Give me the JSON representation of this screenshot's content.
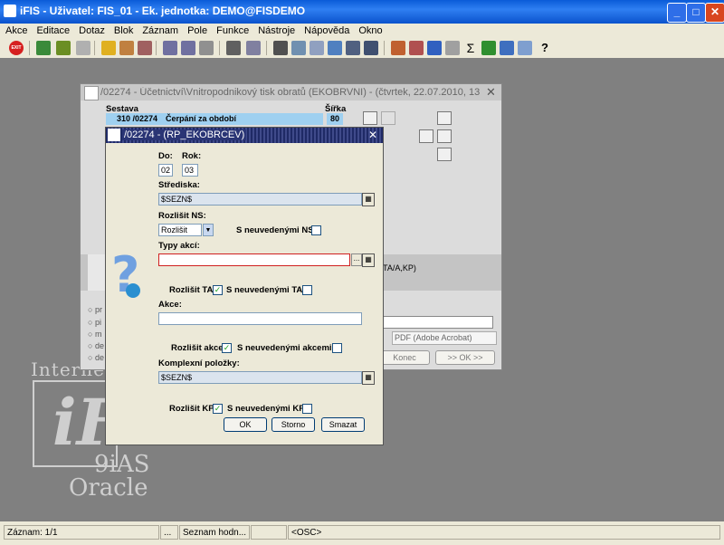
{
  "window": {
    "title": "iFIS - Uživatel: FIS_01 - Ek. jednotka: DEMO@FISDEMO",
    "min": "_",
    "max": "□",
    "close": "✕"
  },
  "menu": [
    "Akce",
    "Editace",
    "Dotaz",
    "Blok",
    "Záznam",
    "Pole",
    "Funkce",
    "Nástroje",
    "Nápověda",
    "Okno"
  ],
  "toolbar": {
    "exit_label": "EXIT",
    "icons": [
      "exit-icon",
      "save-icon",
      "print-icon",
      "folder-open-icon",
      "lock-icon",
      "db-icon",
      "sort-asc-icon",
      "sort-desc-icon",
      "filter-icon",
      "printer-icon",
      "preview-icon",
      "cut-icon",
      "copy-icon",
      "find-icon",
      "find-next-icon",
      "list-icon",
      "tree-icon",
      "calc-icon",
      "warning-icon",
      "triangle-icon",
      "clock-icon",
      "sum-icon",
      "excel-icon",
      "table-icon",
      "info-icon",
      "help-icon"
    ]
  },
  "logo": {
    "internet": "Interne",
    "oracle_9ias": "9iAS",
    "oracle": "Oracle"
  },
  "back_dialog": {
    "title": "/02274 - Účetnictví\\Vnitropodnikový tisk obratů (EKOBRVNI) - (čtvrtek, 22.07.2010, 13:40:52)",
    "close": "✕",
    "col_sestava": "Sestava",
    "col_sirka": "Šířka",
    "row_code": "310 /02274",
    "row_name": "Čerpání za období",
    "row_width": "80",
    "param_text": "TA/A,KP)",
    "radio_labels": [
      "pr",
      "pi",
      "m",
      "de",
      "de"
    ],
    "format_select": "PDF (Adobe Acrobat)",
    "btn_konec": "Konec",
    "btn_ok": ">> OK >>"
  },
  "front_dialog": {
    "title": "/02274 - (RP_EKOBRCEV)",
    "close": "✕",
    "lbl_do": "Do:",
    "lbl_rok": "Rok:",
    "val_do": "02",
    "val_rok": "03",
    "lbl_strediska": "Střediska:",
    "val_strediska": "$SEZN$",
    "lbl_rozlisit_ns": "Rozlišit NS:",
    "val_rozlisit_ns": "Rozlišit",
    "lbl_s_neuvedenymi_ns": "S neuvedenými NS",
    "lbl_typy_akci": "Typy akcí:",
    "val_typy_akci": "",
    "lbl_rozlisit_ta": "Rozlišit TA",
    "lbl_s_neuvedenymi_ta": "S neuvedenými TA",
    "lbl_akce": "Akce:",
    "val_akce": "",
    "lbl_rozlisit_akce": "Rozlišit akce",
    "lbl_s_neuvedenymi_akcemi": "S neuvedenými akcemi",
    "lbl_komplexni": "Komplexní položky:",
    "val_komplexni": "$SEZN$",
    "lbl_rozlisit_kp": "Rozlišit KP",
    "lbl_s_neuvedenymi_kp": "S neuvedenými KP",
    "btn_ok": "OK",
    "btn_storno": "Storno",
    "btn_smazat": "Smazat",
    "check_mark": "✓",
    "dropdown_arrow": "▼",
    "ellipsis": "...",
    "grid_glyph": "▦"
  },
  "status": {
    "record": "Záznam: 1/1",
    "dots": "...",
    "list": "Seznam hodn...",
    "osc": "<OSC>"
  }
}
